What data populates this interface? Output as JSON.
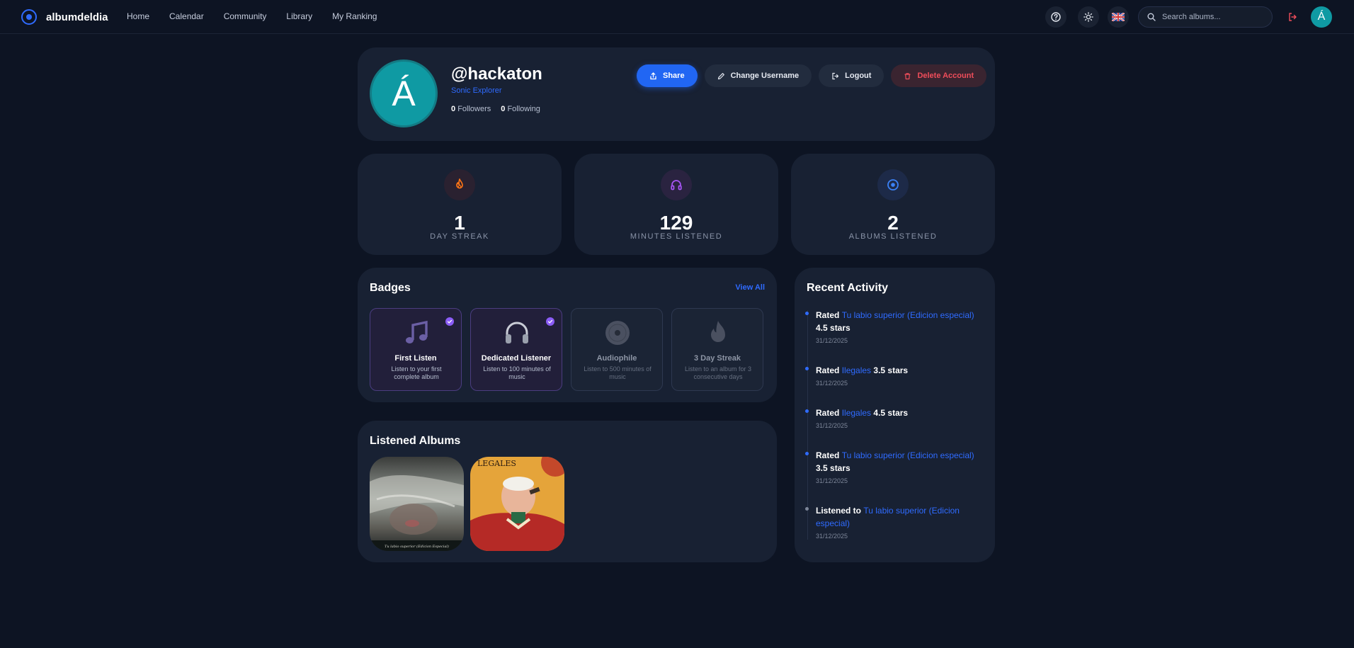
{
  "nav": {
    "brand": "albumdeldia",
    "links": [
      "Home",
      "Calendar",
      "Community",
      "Library",
      "My Ranking"
    ],
    "search_placeholder": "Search albums...",
    "avatar_initial": "Á",
    "icons": [
      "help-icon",
      "sun-icon",
      "uk-flag-icon",
      "logout-icon"
    ]
  },
  "profile": {
    "avatar_initial": "Á",
    "username": "@hackaton",
    "title": "Sonic Explorer",
    "followers_count": "0",
    "followers_label": "Followers",
    "following_count": "0",
    "following_label": "Following",
    "buttons": {
      "share": "Share",
      "change_username": "Change Username",
      "logout": "Logout",
      "delete": "Delete Account"
    },
    "colors": {
      "avatar": "#0f9aa3",
      "primary": "#2166f3",
      "danger": "#ef4d5a"
    }
  },
  "stats": [
    {
      "value": "1",
      "label": "DAY STREAK",
      "icon": "flame-icon",
      "color": "#f97316"
    },
    {
      "value": "129",
      "label": "MINUTES LISTENED",
      "icon": "headphones-icon",
      "color": "#a855f7"
    },
    {
      "value": "2",
      "label": "ALBUMS LISTENED",
      "icon": "disc-icon",
      "color": "#3b82f6"
    }
  ],
  "badges": {
    "title": "Badges",
    "view_all": "View All",
    "items": [
      {
        "name": "First Listen",
        "desc": "Listen to your first complete album",
        "earned": true,
        "icon": "music-note-icon"
      },
      {
        "name": "Dedicated Listener",
        "desc": "Listen to 100 minutes of music",
        "earned": true,
        "icon": "headphones-icon"
      },
      {
        "name": "Audiophile",
        "desc": "Listen to 500 minutes of music",
        "earned": false,
        "icon": "vinyl-icon"
      },
      {
        "name": "3 Day Streak",
        "desc": "Listen to an album for 3 consecutive days",
        "earned": false,
        "icon": "flame-icon"
      }
    ]
  },
  "albums": {
    "title": "Listened Albums",
    "items": [
      {
        "caption": "Tu labio superior (Edicion Especial)"
      },
      {
        "caption": "LEGALES"
      }
    ]
  },
  "activity": {
    "title": "Recent Activity",
    "items": [
      {
        "prefix": "Rated",
        "album": "Tu labio superior (Edicion especial)",
        "suffix": "4.5 stars",
        "date": "31/12/2025"
      },
      {
        "prefix": "Rated",
        "album": "Ilegales",
        "suffix": "3.5 stars",
        "date": "31/12/2025"
      },
      {
        "prefix": "Rated",
        "album": "Ilegales",
        "suffix": "4.5 stars",
        "date": "31/12/2025"
      },
      {
        "prefix": "Rated",
        "album": "Tu labio superior (Edicion especial)",
        "suffix": "3.5 stars",
        "date": "31/12/2025"
      },
      {
        "prefix": "Listened to",
        "album": "Tu labio superior (Edicion especial)",
        "suffix": "",
        "date": "31/12/2025"
      }
    ]
  }
}
